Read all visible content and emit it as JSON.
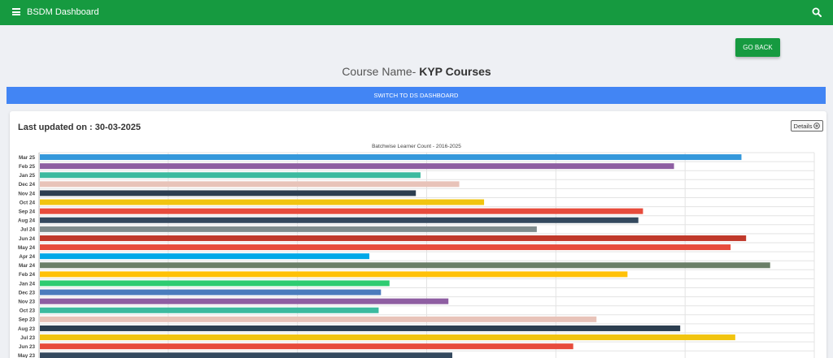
{
  "header": {
    "title": "BSDM Dashboard"
  },
  "actions": {
    "go_back_label": "GO BACK",
    "switch_label": "SWITCH TO DS DASHBOARD",
    "details_label": "Details"
  },
  "course": {
    "prefix": "Course Name- ",
    "name": "KYP Courses"
  },
  "last_updated": "Last updated on : 30-03-2025",
  "colors": {
    "header": "#169a40",
    "switch_bar": "#4285f4"
  },
  "chart_data": {
    "type": "bar",
    "orientation": "horizontal",
    "title": "Batchwise Learner Count - 2016-2025",
    "grid": true,
    "categories": [
      "Mar 25",
      "Feb 25",
      "Jan 25",
      "Dec 24",
      "Nov 24",
      "Oct 24",
      "Sep 24",
      "Aug 24",
      "Jul 24",
      "Jun 24",
      "May 24",
      "Apr 24",
      "Mar 24",
      "Feb 24",
      "Jan 24",
      "Dec 23",
      "Nov 23",
      "Oct 23",
      "Sep 23",
      "Aug 23",
      "Jul 23",
      "Jun 23",
      "May 23"
    ],
    "values": [
      0.905,
      0.818,
      0.491,
      0.541,
      0.485,
      0.573,
      0.778,
      0.772,
      0.641,
      0.911,
      0.891,
      0.425,
      0.942,
      0.758,
      0.451,
      0.44,
      0.527,
      0.437,
      0.718,
      0.826,
      0.897,
      0.688,
      0.532
    ],
    "xlim": [
      0,
      1
    ],
    "colors": [
      "#3498db",
      "#8e5ea2",
      "#3cba9f",
      "#e8c3b9",
      "#2c3e50",
      "#f1c40f",
      "#e74c3c",
      "#34495e",
      "#7f8c8d",
      "#c0392b",
      "#e74c3c",
      "#00a8e8",
      "#6b7f68",
      "#ffc107",
      "#2ecc71",
      "#4b7bbd",
      "#8e5ea2",
      "#3cba9f",
      "#e8c3b9",
      "#2c3e50",
      "#f1c40f",
      "#e74c3c",
      "#34495e"
    ]
  }
}
